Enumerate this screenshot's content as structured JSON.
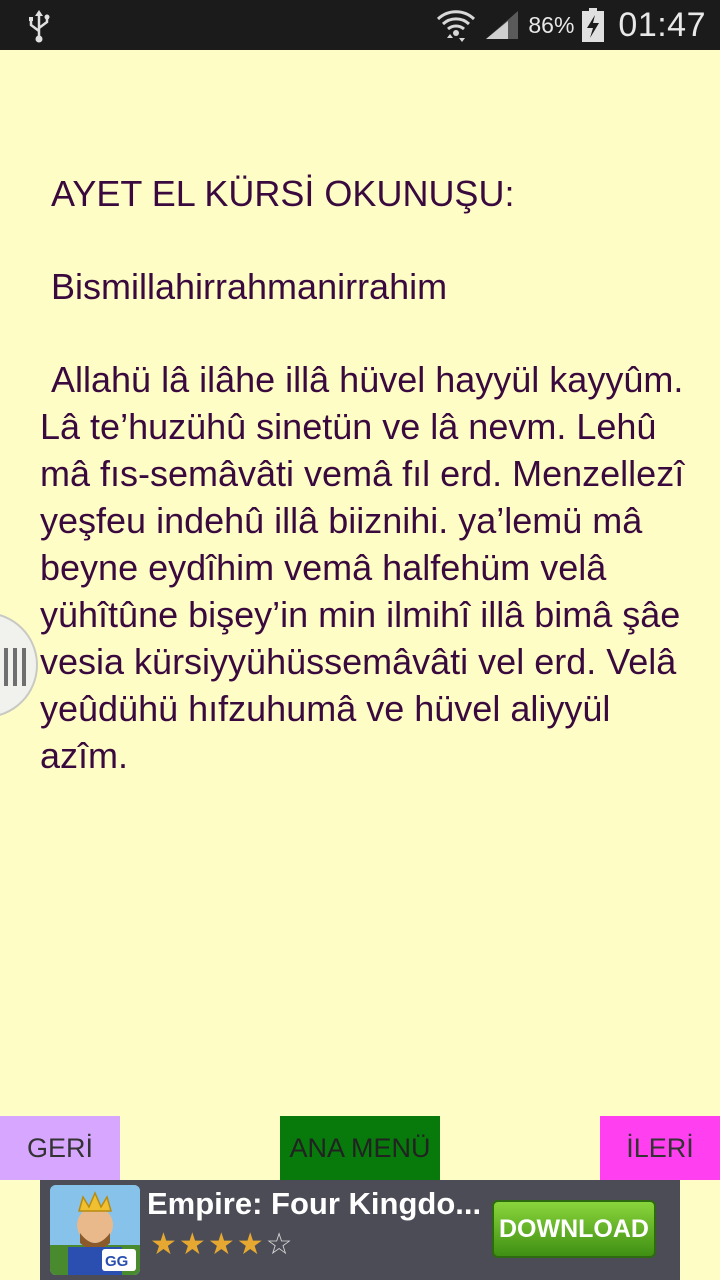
{
  "status_bar": {
    "battery_percent": "86%",
    "time": "01:47",
    "icons": [
      "usb-icon",
      "wifi-icon",
      "signal-icon",
      "battery-charging-icon"
    ]
  },
  "content": {
    "heading": "AYET EL KÜRSİ OKUNUŞU:",
    "bismillah": "Bismillahirrahmanirrahim",
    "verse": "Allahü lâ ilâhe illâ hüvel hayyül kayyûm. Lâ te’huzühû sinetün ve lâ nevm. Lehû mâ fıs-semâvâti vemâ fıl erd. Menzellezî yeşfeu indehû illâ biiznihi. ya’lemü mâ beyne eydîhim vemâ halfehüm velâ yühîtûne bişey’in min ilmihî illâ bimâ şâe vesia kürsiyyühüssemâvâti vel erd. Velâ yeûdühü hıfzuhumâ ve hüvel aliyyül azîm."
  },
  "nav": {
    "back_label": "GERİ",
    "menu_label": "ANA MENÜ",
    "next_label": "İLERİ",
    "colors": {
      "back": "#d7a6ff",
      "menu": "#077a0b",
      "next": "#ff3ff0"
    }
  },
  "ad": {
    "title": "Empire: Four Kingdo...",
    "rating": 4,
    "rating_max": 5,
    "button_label": "DOWNLOAD"
  },
  "colors": {
    "background": "#fffdc6",
    "text": "#3a0a3f"
  }
}
